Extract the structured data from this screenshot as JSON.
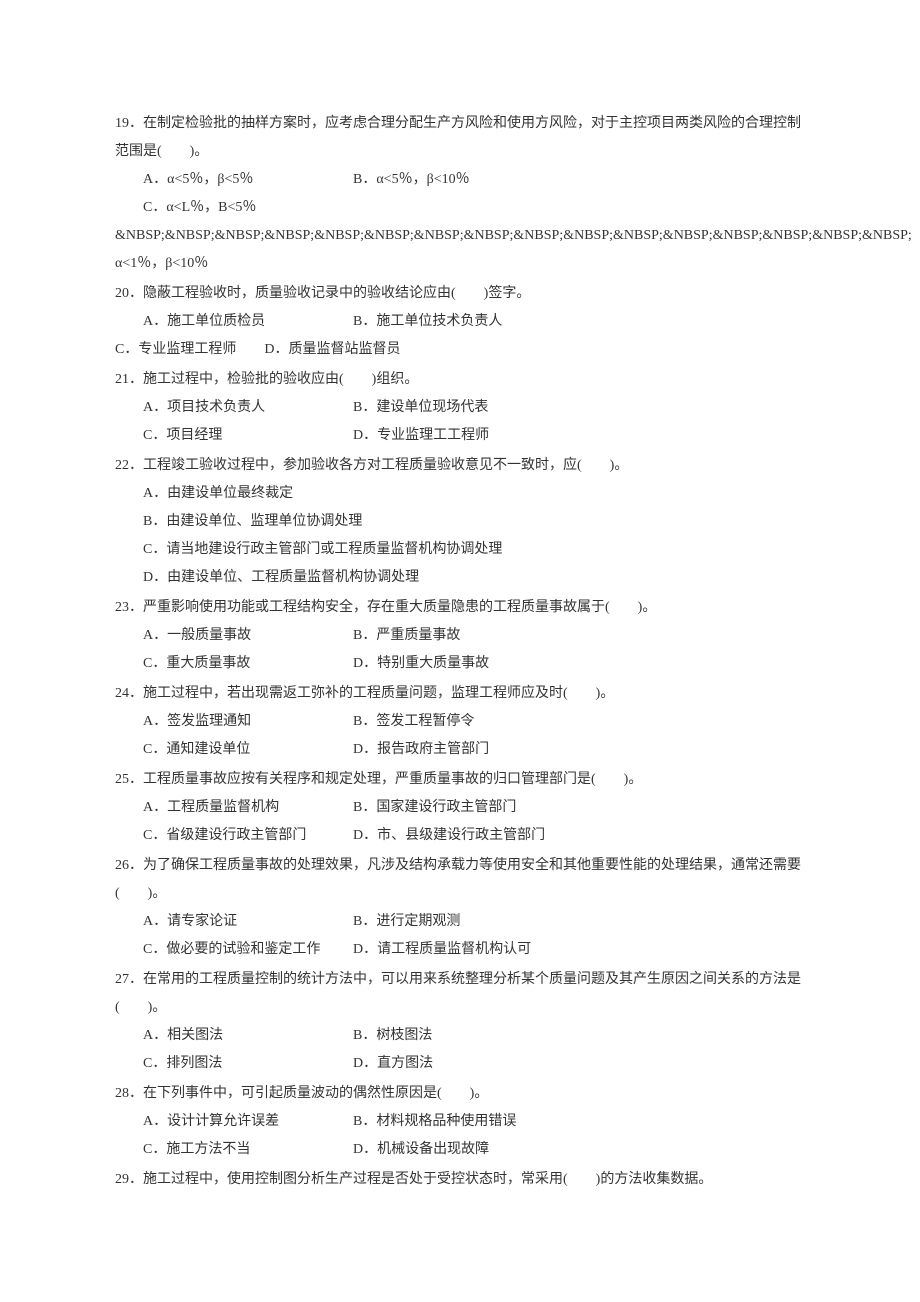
{
  "questions": [
    {
      "num": "19",
      "stem": "在制定检验批的抽样方案时，应考虑合理分配生产方风险和使用方风险，对于主控项目两类风险的合理控制范围是(　　)。",
      "row1_a": "A．α<5％，β<5％",
      "row1_b": "B．α<5％，β<10％",
      "row2_a": "C．α<L％，B<5％",
      "nbsp_line": "&NBSP;&NBSP;&NBSP;&NBSP;&NBSP;&NBSP;&NBSP;&NBSP;&NBSP;&NBSP;&NBSP;&NBSP;&NBSP;&NBSP;&NBSP;&NBSP; α<1％，β<10％"
    },
    {
      "num": "20",
      "stem": "隐蔽工程验收时，质量验收记录中的验收结论应由(　　)签字。",
      "row1_a": "A．施工单位质检员",
      "row1_b": "B．施工单位技术负责人",
      "row2_no_indent": "C．专业监理工程师　　D．质量监督站监督员"
    },
    {
      "num": "21",
      "stem": "施工过程中，检验批的验收应由(　　)组织。",
      "row1_a": "A．项目技术负责人",
      "row1_b": "B．建设单位现场代表",
      "row2_a": "C．项目经理",
      "row2_b": "D．专业监理工工程师"
    },
    {
      "num": "22",
      "stem": "工程竣工验收过程中，参加验收各方对工程质量验收意见不一致时，应(　　)。",
      "vlist": [
        "A．由建设单位最终裁定",
        "B．由建设单位、监理单位协调处理",
        "C．请当地建设行政主管部门或工程质量监督机构协调处理",
        "D．由建设单位、工程质量监督机构协调处理"
      ]
    },
    {
      "num": "23",
      "stem": "严重影响使用功能或工程结构安全，存在重大质量隐患的工程质量事故属于(　　)。",
      "row1_a": "A．一般质量事故",
      "row1_b": "B．严重质量事故",
      "row2_a": "C．重大质量事故",
      "row2_b": "D．特别重大质量事故"
    },
    {
      "num": "24",
      "stem": "施工过程中，若出现需返工弥补的工程质量问题，监理工程师应及时(　　)。",
      "row1_a": "A．签发监理通知",
      "row1_b": "B．签发工程暂停令",
      "row2_a": "C．通知建设单位",
      "row2_b": "D．报告政府主管部门"
    },
    {
      "num": "25",
      "stem": "工程质量事故应按有关程序和规定处理，严重质量事故的归口管理部门是(　　)。",
      "row1_a": "A．工程质量监督机构",
      "row1_b": "B．国家建设行政主管部门",
      "row2_a": "C．省级建设行政主管部门",
      "row2_b": "D．市、县级建设行政主管部门"
    },
    {
      "num": "26",
      "stem": "为了确保工程质量事故的处理效果，凡涉及结构承载力等使用安全和其他重要性能的处理结果，通常还需要(　　)。",
      "row1_a": "A．请专家论证",
      "row1_b": "B．进行定期观测",
      "row2_a": "C．做必要的试验和鉴定工作",
      "row2_b": "D．请工程质量监督机构认可"
    },
    {
      "num": "27",
      "stem": "在常用的工程质量控制的统计方法中，可以用来系统整理分析某个质量问题及其产生原因之间关系的方法是(　　)。",
      "row1_a": "A．相关图法",
      "row1_b": "B．树枝图法",
      "row2_a": "C．排列图法",
      "row2_b": "D．直方图法"
    },
    {
      "num": "28",
      "stem": "在下列事件中，可引起质量波动的偶然性原因是(　　)。",
      "row1_a": "A．设计计算允许误差",
      "row1_b": "B．材料规格品种使用错误",
      "row2_a": "C．施工方法不当",
      "row2_b": "D．机械设备出现故障"
    },
    {
      "num": "29",
      "stem": "施工过程中，使用控制图分析生产过程是否处于受控状态时，常采用(　　)的方法收集数据。"
    }
  ]
}
